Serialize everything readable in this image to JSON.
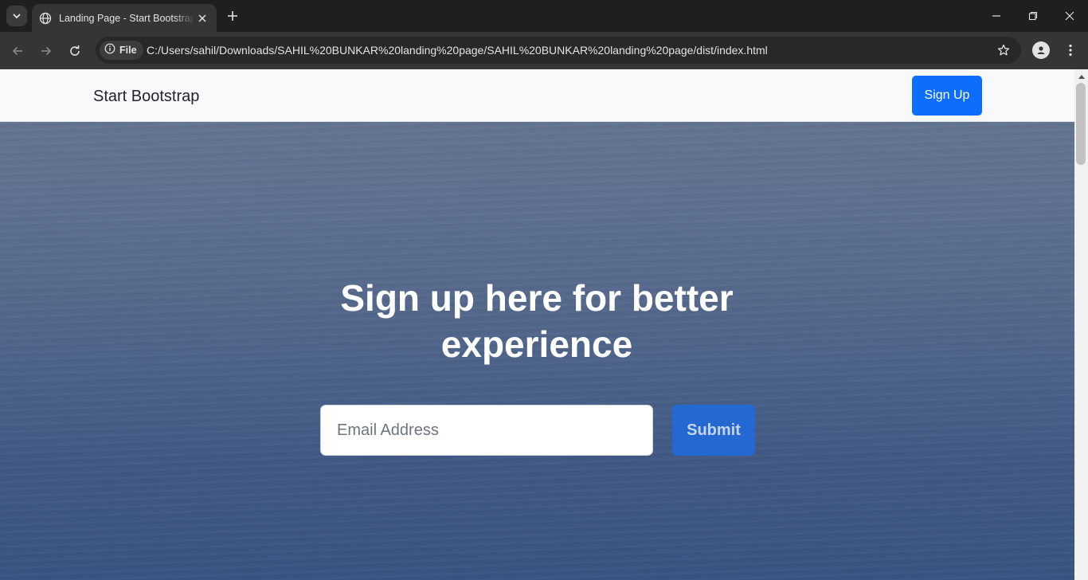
{
  "browser": {
    "tab_title": "Landing Page - Start Bootstrap",
    "chip_label": "File",
    "url": "C:/Users/sahil/Downloads/SAHIL%20BUNKAR%20landing%20page/SAHIL%20BUNKAR%20landing%20page/dist/index.html",
    "icons": [
      "tab-search-icon",
      "globe-icon",
      "close-icon",
      "plus-icon",
      "minimize-icon",
      "restore-icon",
      "close-window-icon",
      "back-icon",
      "forward-icon",
      "reload-icon",
      "info-icon",
      "star-icon",
      "profile-icon",
      "menu-icon"
    ]
  },
  "navbar": {
    "brand": "Start Bootstrap",
    "signup_label": "Sign Up"
  },
  "hero": {
    "headline": "Sign up here for better experience",
    "email_placeholder": "Email Address",
    "submit_label": "Submit"
  },
  "colors": {
    "primary": "#0d6efd",
    "navbar_bg": "#f8f9fa",
    "chrome_dark": "#1f1f1f"
  }
}
